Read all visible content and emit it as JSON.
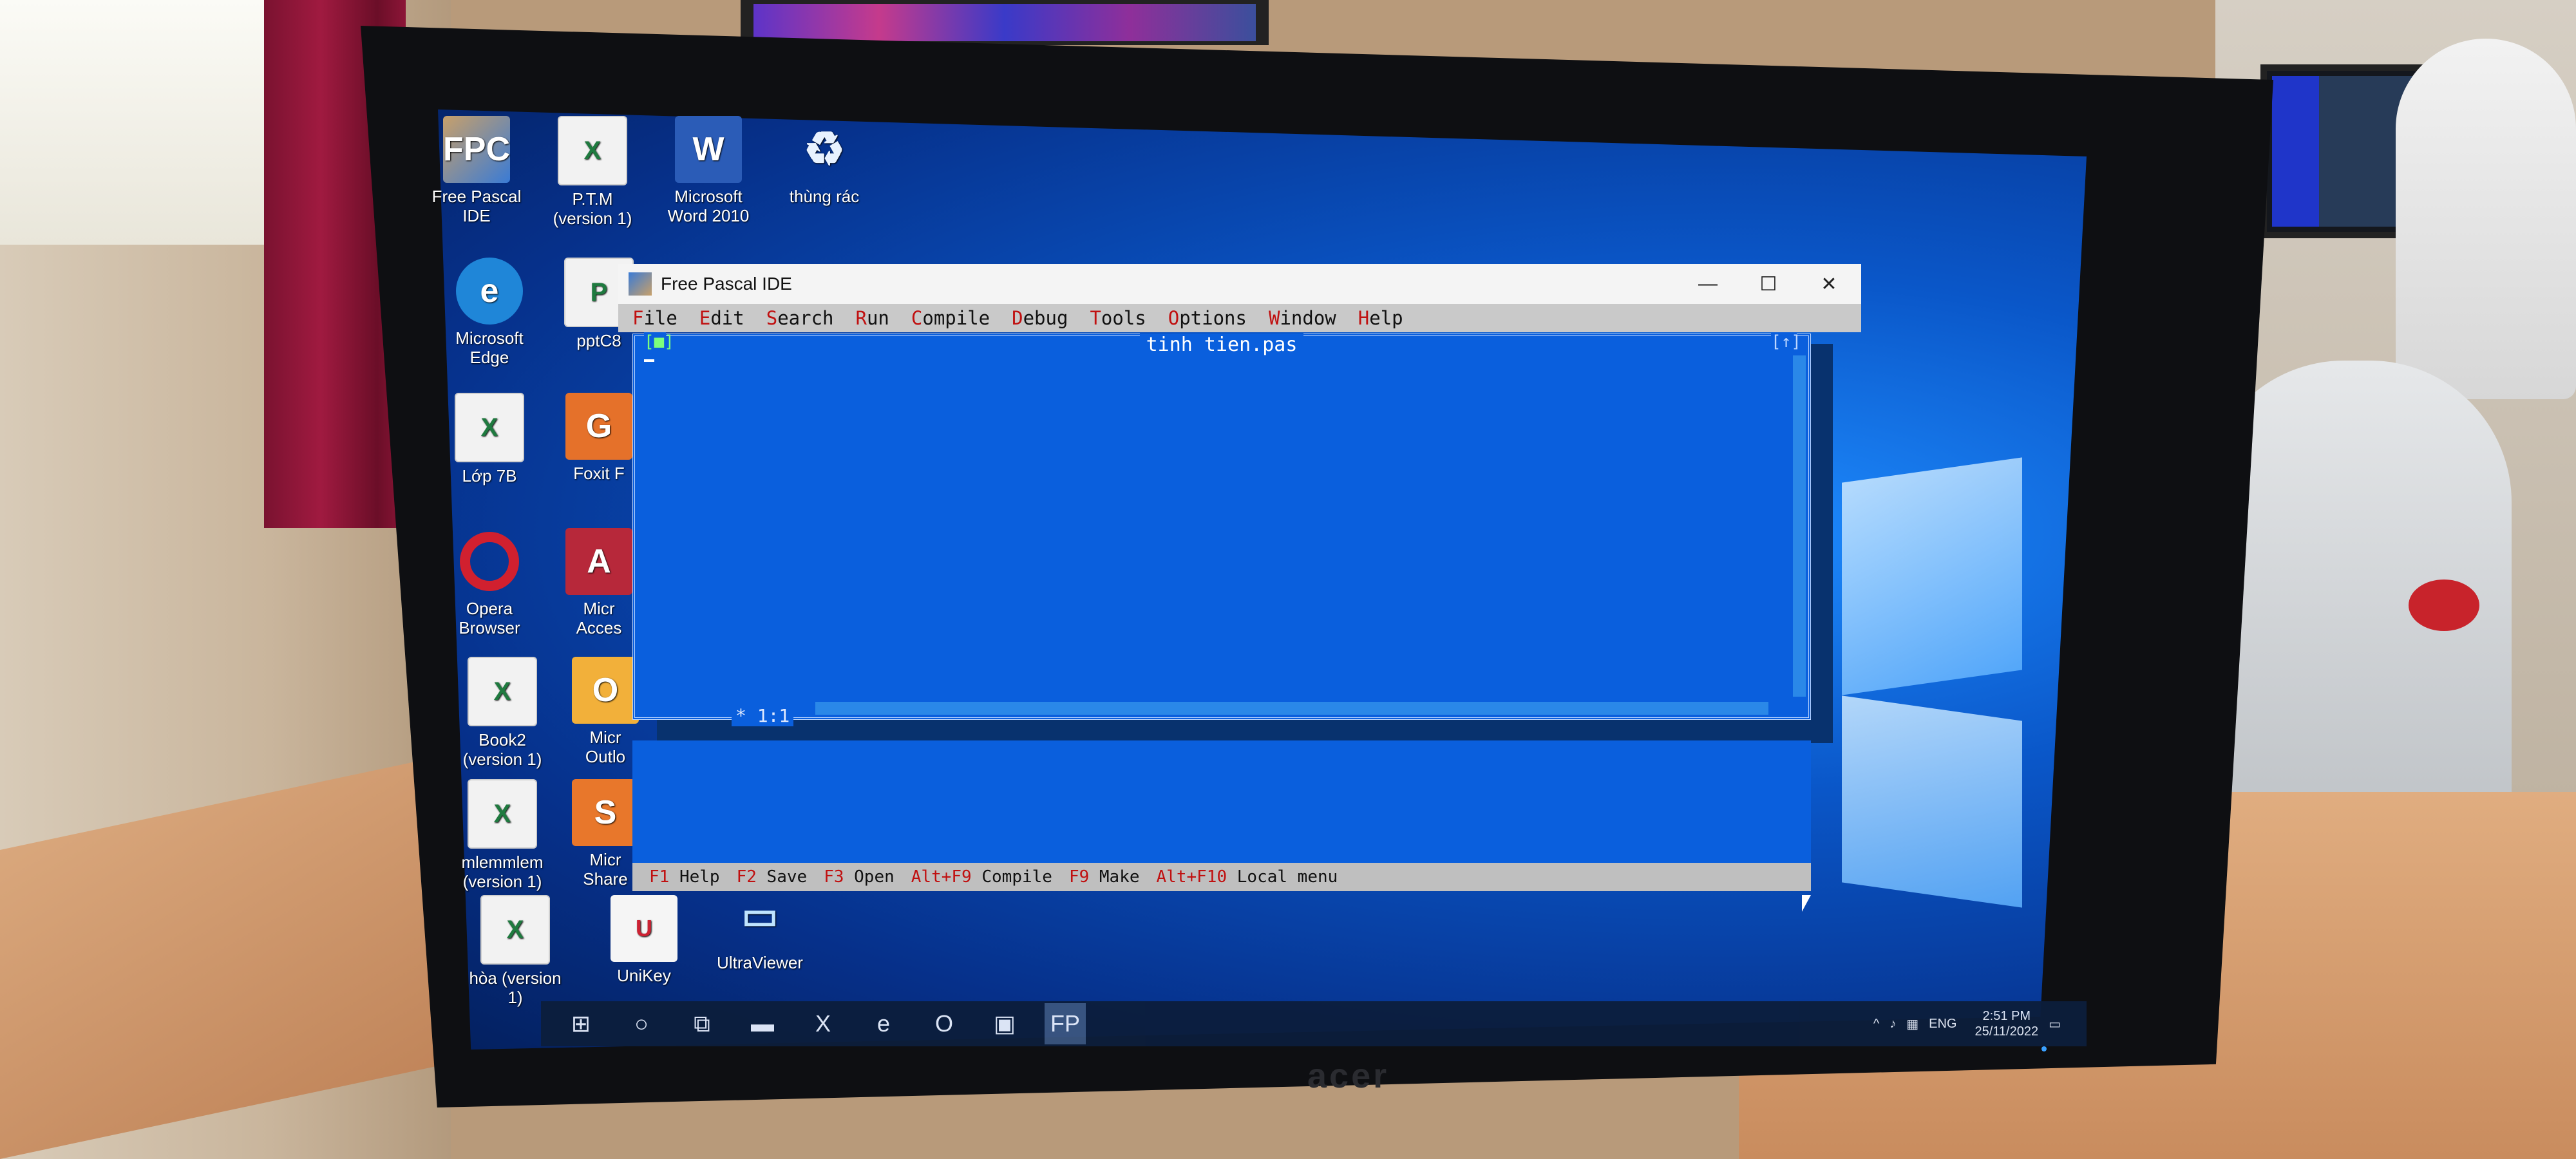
{
  "desktop": {
    "icons": [
      {
        "label": "Free Pascal\nIDE",
        "glyph": "FPC"
      },
      {
        "label": "P.T.M\n(version 1)",
        "glyph": "X"
      },
      {
        "label": "Microsoft\nWord 2010",
        "glyph": "W"
      },
      {
        "label": "thùng rác",
        "glyph": "♻"
      },
      {
        "label": "Microsoft\nEdge",
        "glyph": "e"
      },
      {
        "label": "pptC8",
        "glyph": "P"
      },
      {
        "label": "Lớp 7B",
        "glyph": "X"
      },
      {
        "label": "Foxit F",
        "glyph": "G"
      },
      {
        "label": "Opera\nBrowser",
        "glyph": ""
      },
      {
        "label": "Micr\nAcces",
        "glyph": "A"
      },
      {
        "label": "Book2\n(version 1)",
        "glyph": "X"
      },
      {
        "label": "Micr\nOutlo",
        "glyph": "O"
      },
      {
        "label": "mlemmlem\n(version 1)",
        "glyph": "X"
      },
      {
        "label": "Micr\nShare",
        "glyph": "S"
      },
      {
        "label": "hòa (version\n1)",
        "glyph": "X"
      },
      {
        "label": "UniKey",
        "glyph": "U"
      },
      {
        "label": "UltraViewer",
        "glyph": "▭"
      }
    ]
  },
  "window": {
    "title": "Free Pascal IDE",
    "controls": {
      "minimize": "—",
      "maximize": "☐",
      "close": "✕"
    }
  },
  "menu": [
    {
      "hotkey": "F",
      "rest": "ile"
    },
    {
      "hotkey": "E",
      "rest": "dit"
    },
    {
      "hotkey": "S",
      "rest": "earch"
    },
    {
      "hotkey": "R",
      "rest": "un"
    },
    {
      "hotkey": "C",
      "rest": "ompile"
    },
    {
      "hotkey": "D",
      "rest": "ebug"
    },
    {
      "hotkey": "T",
      "rest": "ools"
    },
    {
      "hotkey": "O",
      "rest": "ptions"
    },
    {
      "hotkey": "W",
      "rest": "indow"
    },
    {
      "hotkey": "H",
      "rest": "elp"
    }
  ],
  "editor": {
    "filename": "tinh tien.pas",
    "close_box": "[■]",
    "zoom_box": "[↑]",
    "modified_marker": "*",
    "position": "1:1"
  },
  "statusbar": [
    {
      "key": "F1",
      "label": "Help"
    },
    {
      "key": "F2",
      "label": "Save"
    },
    {
      "key": "F3",
      "label": "Open"
    },
    {
      "key": "Alt+F9",
      "label": "Compile"
    },
    {
      "key": "F9",
      "label": "Make"
    },
    {
      "key": "Alt+F10",
      "label": "Local menu"
    }
  ],
  "taskbar": {
    "items": [
      "⊞",
      "○",
      "⧉",
      "▬",
      "X",
      "e",
      "O",
      "▣",
      "FP"
    ],
    "tray": {
      "language": "ENG",
      "time": "2:51 PM",
      "date": "25/11/2022"
    }
  },
  "monitor": {
    "brand": "acer"
  },
  "colors": {
    "ide_blue": "#0a5fdd",
    "menu_gray": "#c9c9c9",
    "hotkey_red": "#c01010"
  }
}
